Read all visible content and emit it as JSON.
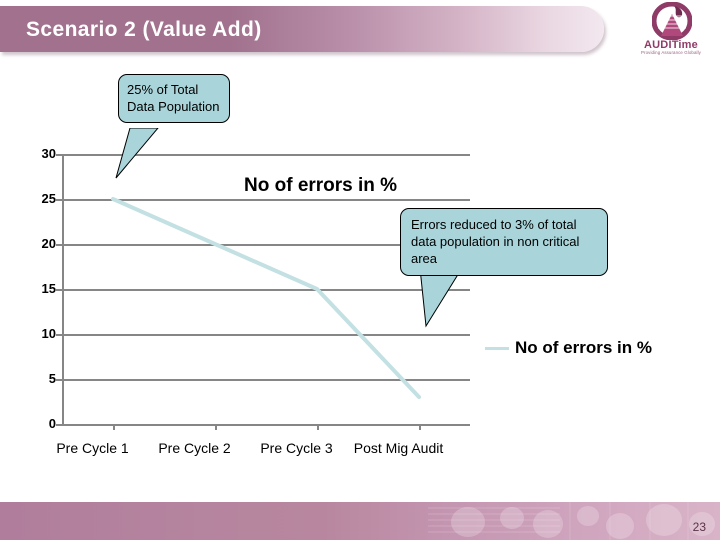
{
  "slide": {
    "title": "Scenario 2 (Value Add)",
    "page_number": "23"
  },
  "logo": {
    "wordmark": "AUDITime",
    "tagline": "Providing Assurance Globally",
    "color": "#8f3b68"
  },
  "callouts": {
    "left": "25% of Total Data Population",
    "right": "Errors reduced to 3% of total data population in non critical area"
  },
  "legend": {
    "label": "No of errors in %"
  },
  "colors": {
    "title_bar": "#a1718d",
    "callout_fill": "#a9d5da",
    "series_line": "#c3e0e3",
    "gridline": "#868686",
    "footer_band": "#b07e9c"
  },
  "chart_data": {
    "type": "line",
    "title": "No of errors in %",
    "xlabel": "",
    "ylabel": "",
    "categories": [
      "Pre Cycle 1",
      "Pre Cycle 2",
      "Pre Cycle 3",
      "Post Mig Audit"
    ],
    "series": [
      {
        "name": "No of errors in %",
        "values": [
          25,
          20,
          15,
          3
        ],
        "color": "#c3e0e3"
      }
    ],
    "ylim": [
      0,
      30
    ],
    "yticks": [
      30,
      25,
      20,
      15,
      10,
      5,
      0
    ],
    "ytick_labels": [
      "30",
      "25",
      "20",
      "15",
      "10",
      "5",
      "0"
    ],
    "grid": true,
    "legend_position": "right"
  }
}
